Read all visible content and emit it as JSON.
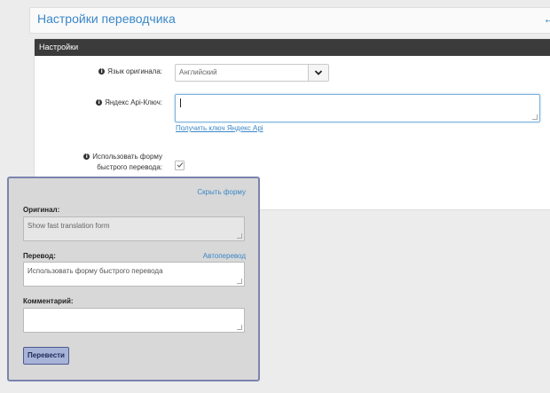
{
  "header": {
    "title": "Настройки переводчика",
    "back_label": "←"
  },
  "panel": {
    "heading": "Настройки",
    "source_language": {
      "label": "Язык оригинала:",
      "value": "Английский"
    },
    "api_key": {
      "label": "Яндекс Api-Ключ:",
      "value": "",
      "link": "Получить ключ Яндекс Api"
    },
    "quick_form": {
      "label_line1": "Использовать форму",
      "label_line2": "быстрого перевода:",
      "checked": true
    }
  },
  "overlay": {
    "hide_link": "Скрыть форму",
    "original_label": "Оригинал:",
    "original_text": "Show fast translation form",
    "translation_label": "Перевод:",
    "auto_link": "Автоперевод",
    "translation_text": "Использовать форму быстрого перевода",
    "comment_label": "Комментарий:",
    "comment_text": "",
    "translate_button": "Перевести"
  },
  "icons": {
    "info": "info-icon",
    "dropdown": "chevron-down-icon",
    "check": "check-icon"
  },
  "colors": {
    "accent": "#3a87c8",
    "panel_header": "#3b3b3b",
    "overlay_border": "#7b84ad",
    "button_bg": "#a8b3d8"
  }
}
